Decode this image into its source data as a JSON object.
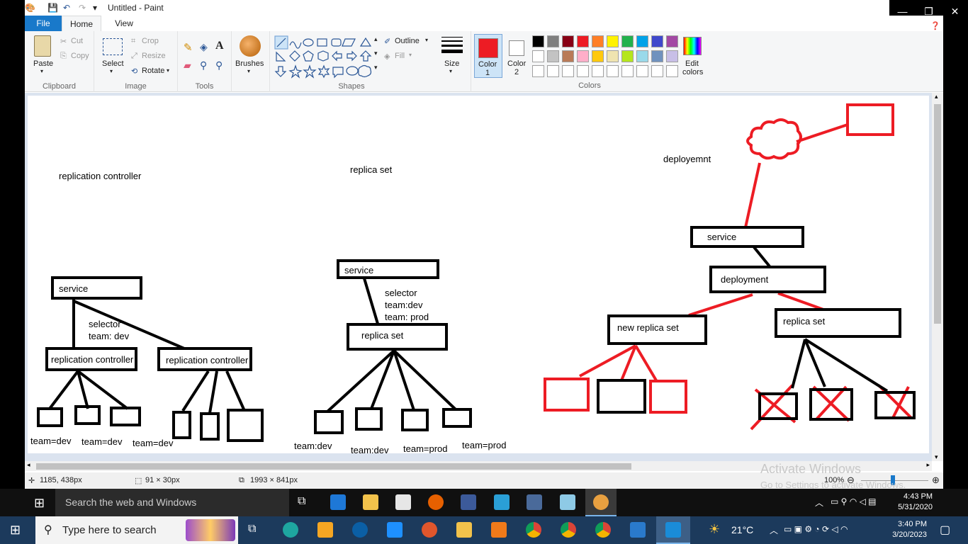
{
  "window": {
    "title": "Untitled - Paint"
  },
  "tabs": {
    "file": "File",
    "home": "Home",
    "view": "View"
  },
  "ribbon": {
    "clipboard": {
      "label": "Clipboard",
      "paste": "Paste",
      "cut": "Cut",
      "copy": "Copy"
    },
    "image": {
      "label": "Image",
      "select": "Select",
      "crop": "Crop",
      "resize": "Resize",
      "rotate": "Rotate"
    },
    "tools": {
      "label": "Tools"
    },
    "brushes": "Brushes",
    "shapes": {
      "label": "Shapes",
      "outline": "Outline",
      "fill": "Fill"
    },
    "size": "Size",
    "color1": {
      "line1": "Color",
      "line2": "1"
    },
    "color2": {
      "line1": "Color",
      "line2": "2"
    },
    "colors": {
      "label": "Colors"
    },
    "edit_colors": {
      "line1": "Edit",
      "line2": "colors"
    },
    "palette_colors": [
      "#000000",
      "#7f7f7f",
      "#880015",
      "#ed1c24",
      "#ff7f27",
      "#fff200",
      "#22b14c",
      "#00a2e8",
      "#3f48cc",
      "#a349a4",
      "#ffffff",
      "#c3c3c3",
      "#b97a57",
      "#ffaec9",
      "#ffc90e",
      "#efe4b0",
      "#b5e61d",
      "#99d9ea",
      "#7092be",
      "#c8bfe7"
    ],
    "color1_value": "#ed1c24"
  },
  "canvas": {
    "labels": {
      "rc_title": "replication controller",
      "rs_title": "replica set",
      "dep_title": "deployemnt",
      "svc": "service",
      "selector": "selector",
      "team_dev_sp": "team: dev",
      "team_dev": "team:dev",
      "team_prod_sp": "team: prod",
      "rc_box": "replication controller",
      "rs_box": "replica set",
      "deployment_box": "deployment",
      "new_rs_box": "new replica set",
      "team_eq_dev": "team=dev",
      "team_eq_prod": "team=prod"
    }
  },
  "status": {
    "cursor": "1185, 438px",
    "selection": "91 × 30px",
    "canvas_size": "1993 × 841px",
    "zoom": "100%"
  },
  "watermark": {
    "line1": "Activate Windows",
    "line2": "Go to Settings to activate Windows."
  },
  "inner_taskbar": {
    "search": "Search the web and Windows",
    "time": "4:43 PM",
    "date": "5/31/2020"
  },
  "outer_taskbar": {
    "search": "Type here to search",
    "weather": "21°C",
    "time": "3:40 PM",
    "date": "3/20/2023"
  }
}
